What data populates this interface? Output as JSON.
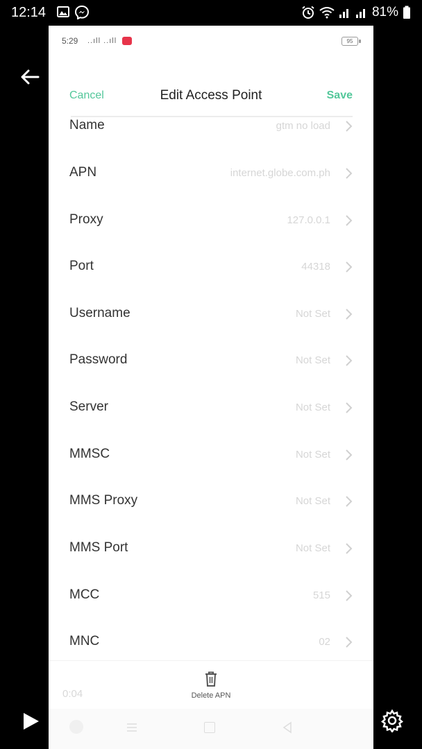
{
  "outer_status": {
    "time": "12:14",
    "battery": "81%"
  },
  "inner_status": {
    "time": "5:29",
    "signal": "..ıll ..ıll",
    "battery": "95"
  },
  "header": {
    "cancel": "Cancel",
    "title": "Edit Access Point",
    "save": "Save"
  },
  "rows": [
    {
      "label": "Name",
      "value": "gtm no load"
    },
    {
      "label": "APN",
      "value": "internet.globe.com.ph"
    },
    {
      "label": "Proxy",
      "value": "127.0.0.1"
    },
    {
      "label": "Port",
      "value": "44318"
    },
    {
      "label": "Username",
      "value": "Not Set"
    },
    {
      "label": "Password",
      "value": "Not Set"
    },
    {
      "label": "Server",
      "value": "Not Set"
    },
    {
      "label": "MMSC",
      "value": "Not Set"
    },
    {
      "label": "MMS Proxy",
      "value": "Not Set"
    },
    {
      "label": "MMS Port",
      "value": "Not Set"
    },
    {
      "label": "MCC",
      "value": "515"
    },
    {
      "label": "MNC",
      "value": "02"
    }
  ],
  "footer": {
    "delete_label": "Delete APN",
    "video_time": "0:04"
  },
  "colors": {
    "accent": "#53c79a",
    "value_text": "#d6d6d6",
    "notification": "#e7344a"
  },
  "icons": [
    "image-icon",
    "messenger-icon",
    "alarm-icon",
    "wifi-icon",
    "signal-icon",
    "battery-icon",
    "back-arrow-icon",
    "play-icon",
    "settings-gear-icon",
    "trash-icon",
    "chevron-right-icon"
  ]
}
